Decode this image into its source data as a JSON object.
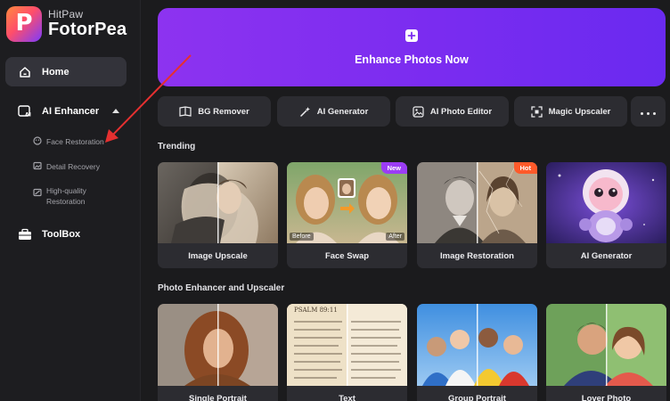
{
  "app": {
    "brand_sub": "HitPaw",
    "brand_name": "FotorPea",
    "accent_color": "#7d2ef0",
    "annotation_arrow_color": "#e53030"
  },
  "sidebar": {
    "home": {
      "label": "Home",
      "icon": "home-icon",
      "selected": true
    },
    "ai_enhancer": {
      "label": "AI Enhancer",
      "icon": "ai-enhancer-icon",
      "expanded": true,
      "items": [
        {
          "label": "Face Restoration",
          "icon": "face-restoration-icon"
        },
        {
          "label": "Detail Recovery",
          "icon": "detail-recovery-icon"
        },
        {
          "label_line1": "High-quality",
          "label_line2": "Restoration",
          "icon": "hq-restoration-icon"
        }
      ]
    },
    "toolbox": {
      "label": "ToolBox",
      "icon": "toolbox-icon"
    }
  },
  "hero": {
    "label": "Enhance Photos Now",
    "icon": "plus-icon"
  },
  "tools": [
    {
      "label": "BG Remover",
      "icon": "bg-remover-icon"
    },
    {
      "label": "AI Generator",
      "icon": "ai-generator-icon"
    },
    {
      "label": "AI Photo Editor",
      "icon": "photo-editor-icon"
    },
    {
      "label": "Magic Upscaler",
      "icon": "upscaler-icon"
    }
  ],
  "more_button": {
    "icon": "more-icon"
  },
  "trending": {
    "title": "Trending",
    "cards": [
      {
        "title": "Image Upscale"
      },
      {
        "title": "Face Swap",
        "badge": "New",
        "badge_color": "#9b3cf5",
        "tag_before": "Before",
        "tag_after": "After"
      },
      {
        "title": "Image Restoration",
        "badge": "Hot",
        "badge_color": "#ff5a2a"
      },
      {
        "title": "AI Generator"
      }
    ]
  },
  "photo_enhancer": {
    "title": "Photo Enhancer and Upscaler",
    "cards": [
      {
        "title": "Single Portrait"
      },
      {
        "title": "Text",
        "psalm_header": "PSALM 89:11"
      },
      {
        "title": "Group Portrait"
      },
      {
        "title": "Lover Photo"
      }
    ]
  }
}
